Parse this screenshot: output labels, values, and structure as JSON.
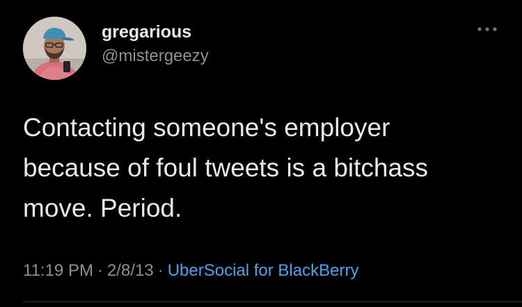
{
  "tweet": {
    "display_name": "gregarious",
    "handle": "@mistergeezy",
    "text": "Contacting someone's employer\nbecause of foul tweets is a bitchass\nmove. Period.",
    "time": "11:19 PM",
    "separator": "·",
    "date": "2/8/13",
    "source": "UberSocial for BlackBerry"
  },
  "icons": {
    "more": "more-horizontal-icon",
    "avatar": "avatar"
  },
  "colors": {
    "background": "#000000",
    "text": "#e7e9ea",
    "secondary": "#8b9197",
    "link": "#4ea1e8"
  }
}
